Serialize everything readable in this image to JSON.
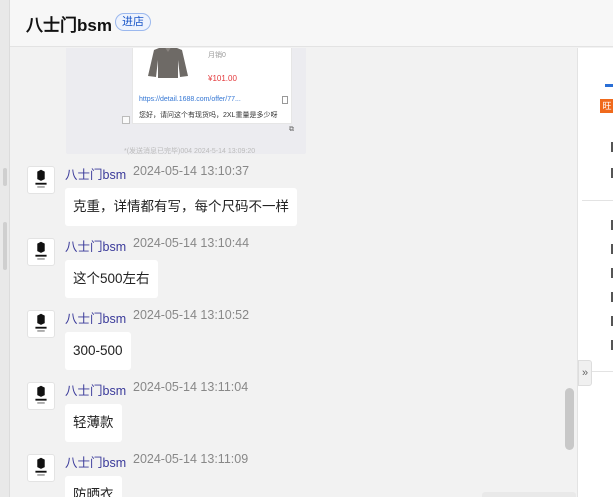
{
  "header": {
    "shop_name": "八士门bsm",
    "enter_label": "进店"
  },
  "card": {
    "sold_label": "月销0",
    "price": "¥101.00",
    "link": "https://detail.1688.com/offer/77...",
    "message": "您好，请问这个有现货吗，2XL重量是多少呀",
    "faded_line": "*(发送消息已完毕)004  2024-5-14 13:09:20"
  },
  "messages": [
    {
      "sender": "八士门bsm",
      "time": "2024-05-14 13:10:37",
      "text": "克重，详情都有写，每个尺码不一样"
    },
    {
      "sender": "八士门bsm",
      "time": "2024-05-14 13:10:44",
      "text": "这个500左右"
    },
    {
      "sender": "八士门bsm",
      "time": "2024-05-14 13:10:52",
      "text": "300-500"
    },
    {
      "sender": "八士门bsm",
      "time": "2024-05-14 13:11:04",
      "text": "轻薄款"
    },
    {
      "sender": "八士门bsm",
      "time": "2024-05-14 13:11:09",
      "text": "防晒衣"
    }
  ],
  "right_panel": {
    "tag_label": "旺",
    "expand_icon": "»"
  },
  "colors": {
    "accent": "#2a6fd6",
    "sender": "#3a3a9a",
    "price": "#e4393c",
    "tag": "#f06a1c"
  }
}
